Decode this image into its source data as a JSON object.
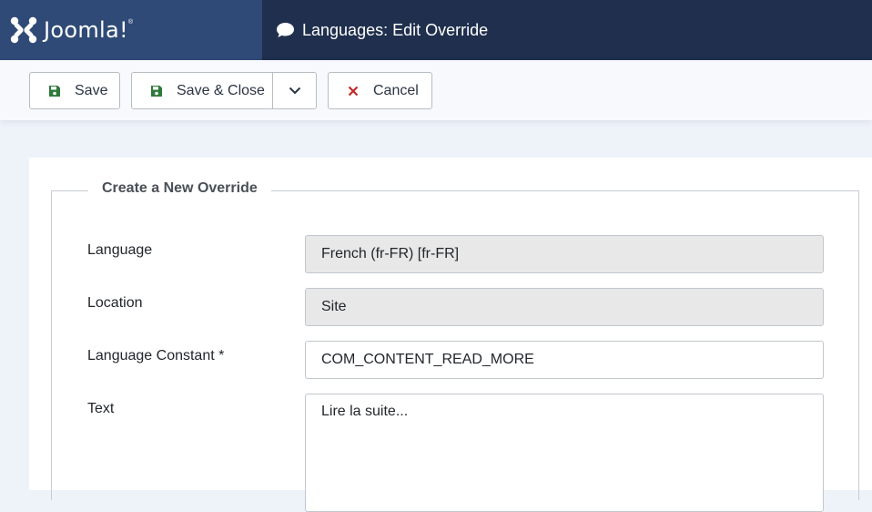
{
  "header": {
    "logo_text": "Joomla!",
    "logo_reg": "®",
    "page_title": "Languages: Edit Override"
  },
  "toolbar": {
    "save_label": "Save",
    "save_close_label": "Save & Close",
    "cancel_label": "Cancel"
  },
  "form": {
    "legend": "Create a New Override",
    "language": {
      "label": "Language",
      "value": "French (fr-FR) [fr-FR]"
    },
    "location": {
      "label": "Location",
      "value": "Site"
    },
    "constant": {
      "label": "Language Constant *",
      "value": "COM_CONTENT_READ_MORE"
    },
    "text": {
      "label": "Text",
      "value": "Lire la suite..."
    }
  },
  "colors": {
    "header_bg": "#1f2f4d",
    "logo_bg": "#2f4a76",
    "save_icon": "#2f7a3b",
    "cancel_icon": "#c52827"
  },
  "icons": {
    "logo": "joomla-logo-icon",
    "title": "comment-icon",
    "save": "floppy-disk-icon",
    "dropdown": "chevron-down-icon",
    "cancel": "times-icon"
  }
}
